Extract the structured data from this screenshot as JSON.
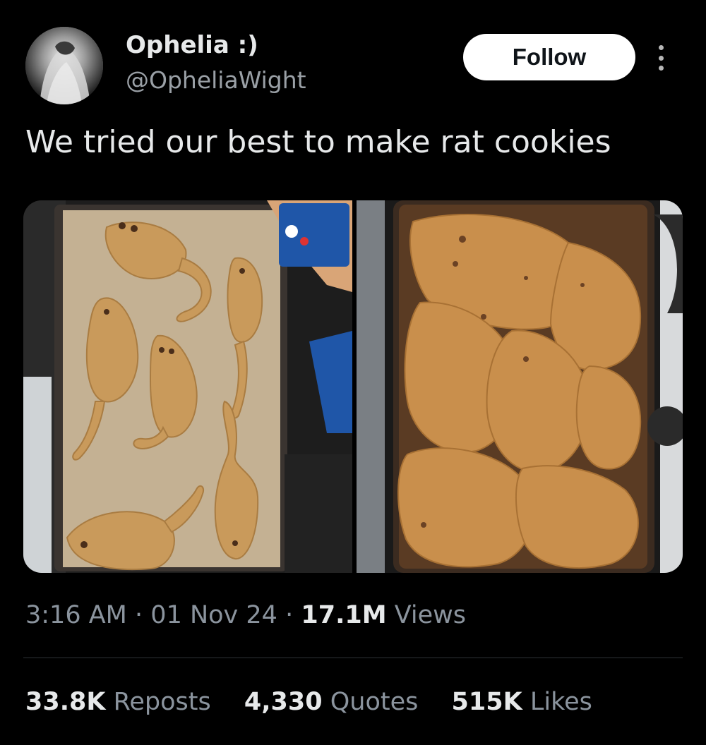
{
  "author": {
    "display_name": "Ophelia :)",
    "handle": "@OpheliaWight",
    "avatar_icon": "profile-photo"
  },
  "actions": {
    "follow_label": "Follow",
    "more_icon": "more-dots-icon"
  },
  "tweet": {
    "text": "We tried our best to make rat cookies"
  },
  "media": {
    "left_alt": "rat-shaped cookie dough on baking tray",
    "right_alt": "baked cookies merged into one slab on tray"
  },
  "meta": {
    "time": "3:16 AM",
    "sep1": "·",
    "date": "01 Nov 24",
    "sep2": "·",
    "views_count": "17.1M",
    "views_label": "Views"
  },
  "stats": {
    "reposts_count": "33.8K",
    "reposts_label": "Reposts",
    "quotes_count": "4,330",
    "quotes_label": "Quotes",
    "likes_count": "515K",
    "likes_label": "Likes"
  },
  "colors": {
    "background": "#000000",
    "text_primary": "#e7e9ea",
    "text_secondary": "#8b949e",
    "follow_bg": "#ffffff",
    "divider": "#2f3336"
  }
}
